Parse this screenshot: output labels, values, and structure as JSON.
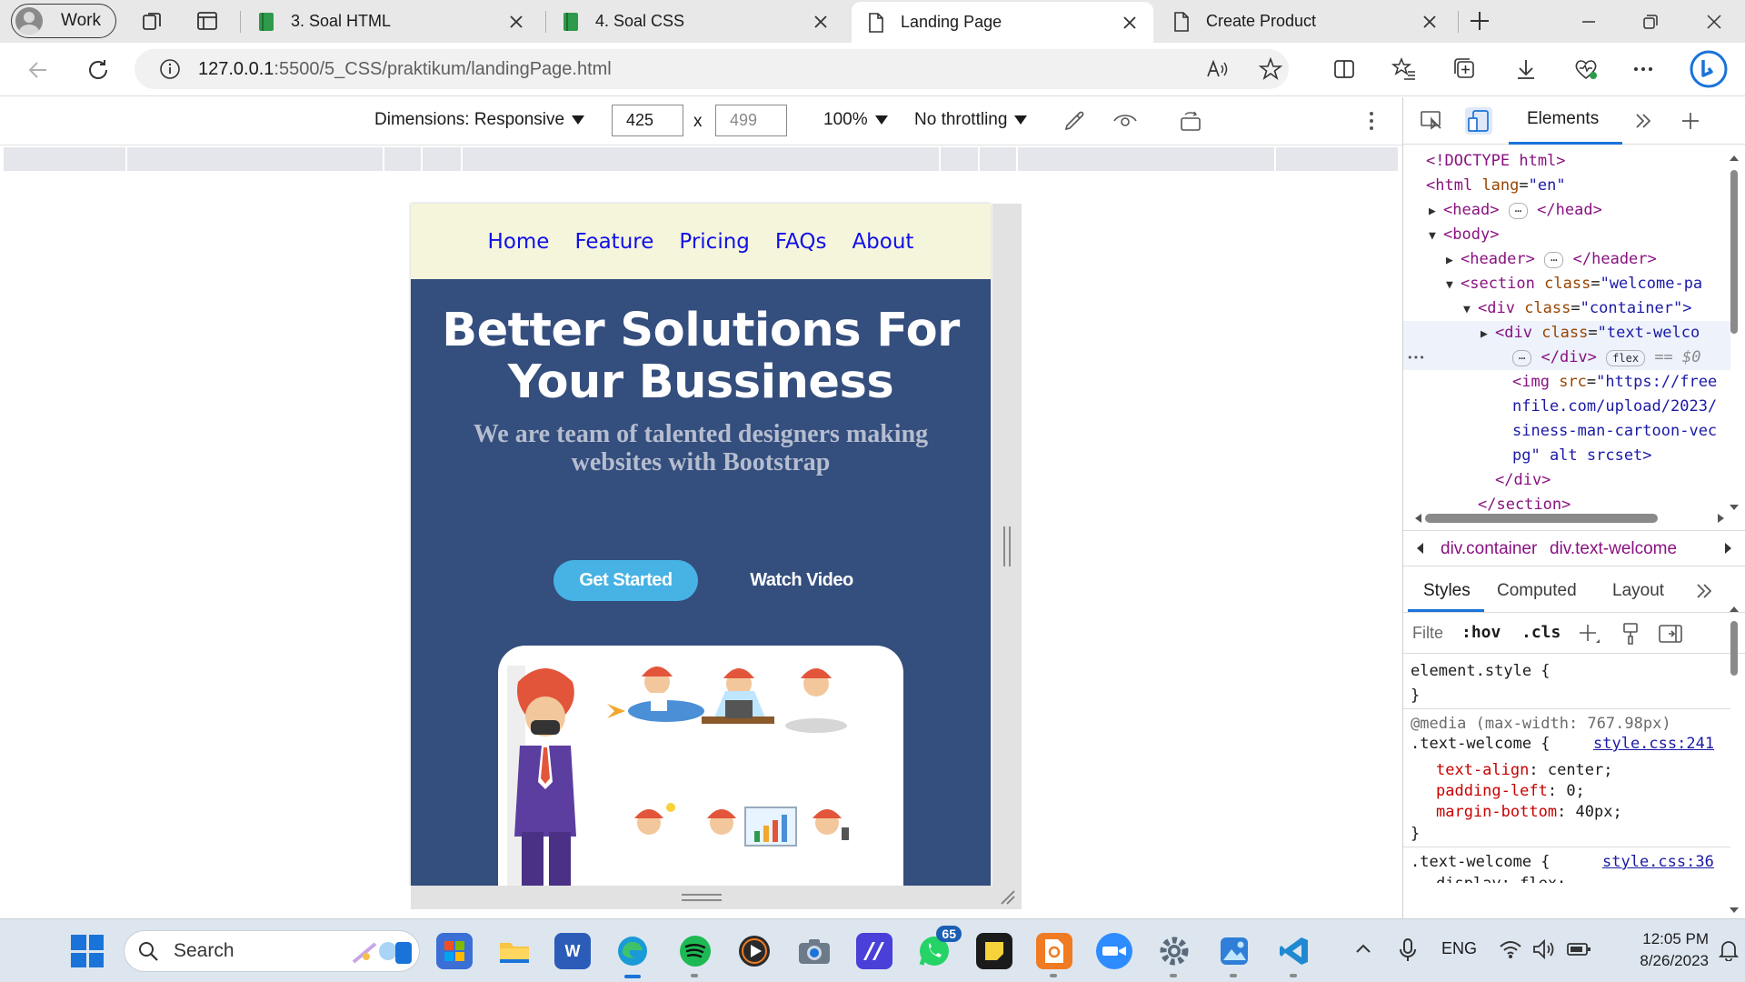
{
  "browser": {
    "profile_label": "Work",
    "tabs": [
      {
        "label": "3. Soal HTML",
        "favicon": "green-book-icon",
        "active": false
      },
      {
        "label": "4. Soal CSS",
        "favicon": "green-book-icon",
        "active": false
      },
      {
        "label": "Landing Page",
        "favicon": "page-icon",
        "active": true
      },
      {
        "label": "Create Product",
        "favicon": "page-icon",
        "active": false
      }
    ],
    "url_host": "127.0.0.1",
    "url_path": ":5500/5_CSS/praktikum/landingPage.html",
    "colors": {
      "tabstrip": "#e8e8e8",
      "edge_accent": "#1a73d9"
    }
  },
  "device_toolbar": {
    "dimensions_label": "Dimensions: Responsive",
    "width": "425",
    "height": "499",
    "times": "x",
    "zoom": "100%",
    "throttling": "No throttling"
  },
  "page": {
    "nav": [
      "Home",
      "Feature",
      "Pricing",
      "FAQs",
      "About"
    ],
    "headline": "Better Solutions For Your Bussiness",
    "tagline": "We are team of talented designers making websites with Bootstrap",
    "cta_primary": "Get Started",
    "cta_secondary": "Watch Video",
    "colors": {
      "header_bg": "#f5f5dc",
      "hero_bg": "#344e7d",
      "cta_bg": "#47b2e4",
      "nav_link": "#1010e8"
    }
  },
  "devtools": {
    "panel_tab": "Elements",
    "dom": [
      {
        "indent": 1,
        "tri": "",
        "html": "<!DOCTYPE html>"
      },
      {
        "indent": 1,
        "tri": "",
        "open": "html",
        "attrs": [
          [
            "lang",
            "\"en\""
          ]
        ],
        "close": ""
      },
      {
        "indent": 2,
        "tri": "▶",
        "open": "head",
        "ellipsis": true,
        "close": "head"
      },
      {
        "indent": 2,
        "tri": "▼",
        "open": "body",
        "close": ""
      },
      {
        "indent": 3,
        "tri": "▶",
        "open": "header",
        "ellipsis": true,
        "close": "header"
      },
      {
        "indent": 3,
        "tri": "▼",
        "open": "section",
        "attrs": [
          [
            "class",
            "\"welcome-pa"
          ]
        ],
        "close": ""
      },
      {
        "indent": 4,
        "tri": "▼",
        "open": "div",
        "attrs": [
          [
            "class",
            "\"container\">"
          ]
        ],
        "close": ""
      },
      {
        "indent": 5,
        "tri": "▶",
        "open": "div",
        "attrs": [
          [
            "class",
            "\"text-welco"
          ]
        ],
        "close": "",
        "selected": true
      },
      {
        "indent": 6,
        "tri": "",
        "tail": "</div>",
        "pill": "flex",
        "eq": "== $0",
        "selected": true,
        "ellipsis_lead": true
      },
      {
        "indent": 6,
        "tri": "",
        "open": "img",
        "attrs": [
          [
            "src",
            "\"https://free"
          ]
        ],
        "close": ""
      },
      {
        "indent": 6,
        "tri": "",
        "text": "nfile.com/upload/2023/"
      },
      {
        "indent": 6,
        "tri": "",
        "text": "siness-man-cartoon-vec"
      },
      {
        "indent": 6,
        "tri": "",
        "text": "pg\" alt srcset>"
      },
      {
        "indent": 5,
        "tri": "",
        "tail": "</div>"
      },
      {
        "indent": 4,
        "tri": "",
        "tail": "</section>"
      }
    ],
    "breadcrumbs": [
      "div.container",
      "div.text-welcome"
    ],
    "style_tabs": [
      "Styles",
      "Computed",
      "Layout"
    ],
    "filter_placeholder": "Filte",
    "hov": ":hov",
    "cls": ".cls",
    "element_style": "element.style {",
    "close_brace": "}",
    "media": "@media (max-width: 767.98px)",
    "rule1_selector": ".text-welcome {",
    "rule1_link": "style.css:241",
    "rule1_props": [
      [
        "text-align",
        "center;"
      ],
      [
        "padding-left",
        "0;"
      ],
      [
        "margin-bottom",
        "40px;"
      ]
    ],
    "rule2_selector": ".text-welcome {",
    "rule2_link": "style.css:36",
    "rule2_partial": "display: flex;"
  },
  "taskbar": {
    "search_label": "Search",
    "whatsapp_badge": "65",
    "language": "ENG",
    "time": "12:05 PM",
    "date": "8/26/2023"
  }
}
